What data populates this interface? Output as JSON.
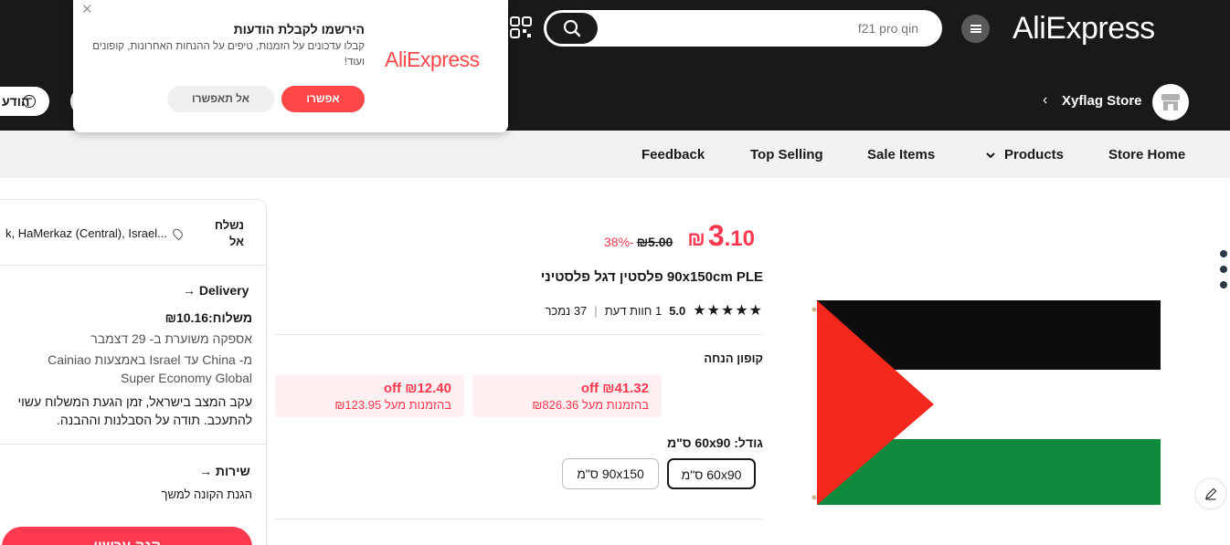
{
  "header": {
    "logo": "AliExpress",
    "search_placeholder": "f21 pro qin",
    "store_name": "Xyflag Store",
    "messages_label": "הודע"
  },
  "nav": {
    "items": [
      "Store Home",
      "Products",
      "Sale Items",
      "Top Selling",
      "Feedback"
    ]
  },
  "popup": {
    "title": "הירשמו לקבלת הודעות",
    "body": "קבלו עדכונים על הזמנות, טיפים על ההנחות האחרונות, קופונים ועוד!",
    "logo": "AliExpress",
    "allow_label": "אפשרו",
    "deny_label": "אל תאפשרו"
  },
  "product": {
    "price_currency": "₪",
    "price_int": "3",
    "price_dec": ".10",
    "discount": "38%-",
    "old_price": "₪5.00",
    "title": "90x150cm PLE פלסטין דגל פלסטיני",
    "rating_score": "5.0",
    "reviews": "1 חוות דעת",
    "sold": "37 נמכר",
    "coupon_label": "קופון הנחה",
    "coupons": [
      {
        "amount": "₪41.32 off",
        "condition": "בהזמנות מעל ₪826.36"
      },
      {
        "amount": "₪12.40 off",
        "condition": "בהזמנות מעל ₪123.95"
      }
    ],
    "size_label": "גודל: 60x90 ס\"מ",
    "sizes": [
      "60x90 ס\"מ",
      "90x150 ס\"מ"
    ],
    "selected_size": "60x90 ס\"מ"
  },
  "shipping": {
    "ship_to_label": "נשלח אל",
    "address": "k, HaMerkaz (Central), Israel...",
    "delivery_title": "Delivery",
    "shipping_cost": "משלוח:₪10.16",
    "eta": "אספקה משוערת ב- 29 דצמבר",
    "route": "מ- China עד Israel באמצעות Cainiao Super Economy Global",
    "notice": "עקב המצב בישראל, זמן הגעת המשלוח עשוי להתעכב. תודה על הסבלנות וההבנה.",
    "service_title": "שירות",
    "service_text": "הגנת הקונה למשך",
    "buy_label": "קנה עכשיו"
  },
  "colors": {
    "accent": "#fd384f",
    "header_bg": "#191919",
    "flag_black": "#0d0d0d",
    "flag_white": "#ffffff",
    "flag_green": "#0f8a3c",
    "flag_red": "#f5281e"
  }
}
